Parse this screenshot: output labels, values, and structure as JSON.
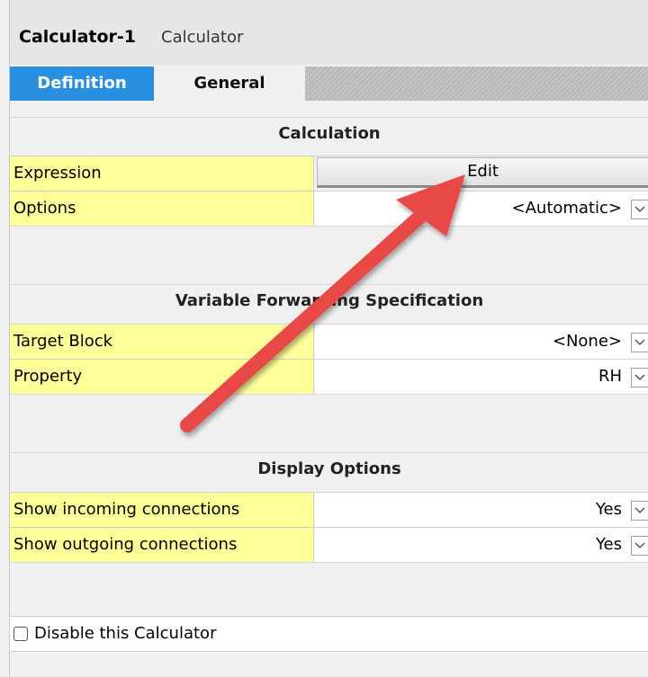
{
  "header": {
    "title": "Calculator-1",
    "subtitle": "Calculator"
  },
  "tabs": [
    {
      "label": "Definition",
      "active": true
    },
    {
      "label": "General",
      "active": false
    }
  ],
  "sections": {
    "calculation": {
      "title": "Calculation",
      "expression": {
        "label": "Expression",
        "button": "Edit"
      },
      "options": {
        "label": "Options",
        "value": "<Automatic>"
      }
    },
    "forwarding": {
      "title": "Variable Forwarding Specification",
      "target_block": {
        "label": "Target Block",
        "value": "<None>"
      },
      "property": {
        "label": "Property",
        "value": "RH"
      }
    },
    "display": {
      "title": "Display Options",
      "incoming": {
        "label": "Show incoming connections",
        "value": "Yes"
      },
      "outgoing": {
        "label": "Show outgoing connections",
        "value": "Yes"
      }
    }
  },
  "disable": {
    "label": "Disable this Calculator",
    "checked": false
  },
  "annotation": {
    "arrow_color": "#e84a46",
    "icon": "red-arrow-icon"
  }
}
